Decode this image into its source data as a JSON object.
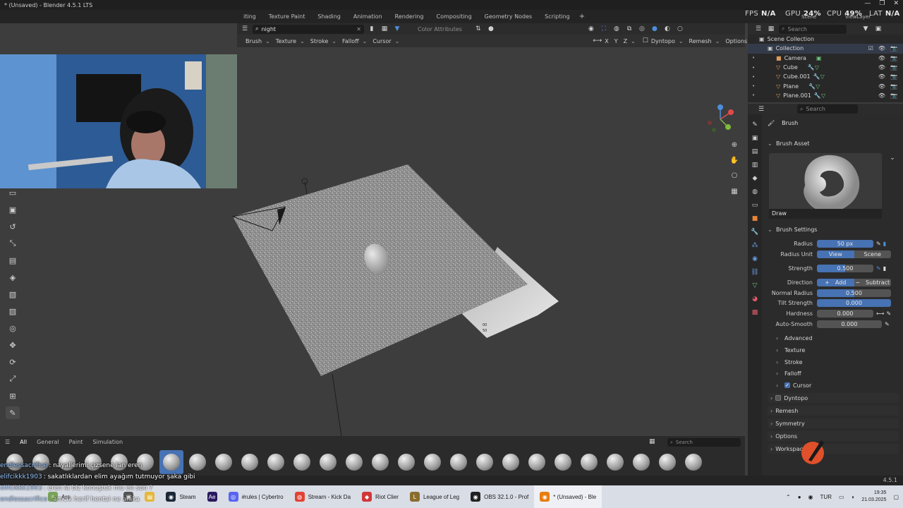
{
  "window": {
    "title": "* (Unsaved) - Blender 4.5.1 LTS",
    "controls": [
      "—",
      "❐",
      "✕"
    ]
  },
  "workspaces": [
    "iting",
    "Texture Paint",
    "Shading",
    "Animation",
    "Rendering",
    "Compositing",
    "Geometry Nodes",
    "Scripting",
    "+"
  ],
  "hud": {
    "fps_label": "FPS",
    "fps_value": "N/A",
    "gpu_label": "GPU",
    "gpu_value": "24%",
    "cpu_label": "CPU",
    "cpu_value": "49%",
    "lat_label": "LAT",
    "lat_value": "N/A",
    "scene": "Scene",
    "view_layer": "ViewLayer"
  },
  "viewport_header": {
    "search_value": "night",
    "color_attributes": "Color Attributes",
    "menus": [
      "Brush",
      "Texture",
      "Stroke",
      "Falloff",
      "Cursor"
    ],
    "axes": [
      "X",
      "Y",
      "Z"
    ],
    "dyntopo": "Dyntopo",
    "remesh": "Remesh",
    "options": "Options"
  },
  "object_label": {
    "a": "00",
    "b": "50"
  },
  "outliner": {
    "search_placeholder": "Search",
    "scene_collection": "Scene Collection",
    "collection": "Collection",
    "items": [
      "Camera",
      "Cube",
      "Cube.001",
      "Plane",
      "Plane.001"
    ]
  },
  "properties": {
    "search_placeholder": "Search",
    "title": "Brush",
    "brush_asset_label": "Brush Asset",
    "brush_name": "Draw",
    "brush_settings_label": "Brush Settings",
    "radius_label": "Radius",
    "radius_value": "50 px",
    "radius_unit_label": "Radius Unit",
    "radius_unit_options": [
      "View",
      "Scene"
    ],
    "strength_label": "Strength",
    "strength_value": "0.500",
    "direction_label": "Direction",
    "direction_options": [
      "Add",
      "Subtract"
    ],
    "normal_radius_label": "Normal Radius",
    "normal_radius_value": "0.500",
    "tilt_strength_label": "Tilt Strength",
    "tilt_strength_value": "0.000",
    "hardness_label": "Hardness",
    "hardness_value": "0.000",
    "auto_smooth_label": "Auto-Smooth",
    "auto_smooth_value": "0.000",
    "subpanels": [
      "Advanced",
      "Texture",
      "Stroke",
      "Falloff",
      "Cursor"
    ],
    "panels": [
      "Dyntopo",
      "Remesh",
      "Symmetry",
      "Options",
      "Workspace"
    ]
  },
  "shelf": {
    "tabs": [
      "All",
      "General",
      "Paint",
      "Simulation"
    ],
    "search_placeholder": "Search"
  },
  "chat": [
    {
      "user": "endlessacrifice",
      "text": ": nayallerimi çizsene lan eren"
    },
    {
      "user": "elifcikkk1903",
      "text": ": sakatlıklardan elim ayağım tutmuyor şaka gibi"
    },
    {
      "user": "elifcikkk1903",
      "text": ": eren la biz konuştuk mu en son ?"
    },
    {
      "user": "endlessacrifice",
      "text": ": amcık herif hentai ne alaka"
    }
  ],
  "status": {
    "version": "4.5.1"
  },
  "taskbar": {
    "search": "Ara",
    "apps": [
      "Steam",
      "#rules | Cybertro",
      "Stream - Kick Da",
      "Riot Clier",
      "League of Leg",
      "OBS 32.1.0 - Prof",
      "* (Unsaved) - Ble"
    ],
    "lang": "TUR",
    "time": "19:35",
    "date": "21.03.2025"
  },
  "colors": {
    "accent": "#4772b3",
    "background": "#3d3d3d",
    "panel": "#2b2b2b"
  }
}
